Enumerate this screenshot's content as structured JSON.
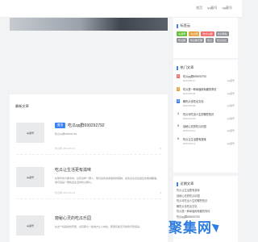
{
  "header": {
    "links": [
      "首页",
      "qq靓号",
      "qq靓号"
    ]
  },
  "main": {
    "section_title": "最新文章",
    "posts": [
      {
        "thumb_label": "qq靓号",
        "tag": "置顶",
        "title": "吃瓜qq群699292792",
        "desc": "吃瓜qq群699292792",
        "meta": "吃瓜网 2024-05-13",
        "count": "5"
      },
      {
        "thumb_label": "qq靓号",
        "tag": "",
        "title": "吃瓜让生活更有滋味",
        "desc": "在繁华的大都市中，总有这样一群人，他们喜欢追求着新鲜事物，喜欢关注身边发生的各种趣事。他们就是一群热爱生活的吃瓜群众。",
        "meta": "吃瓜网 2024-05-13",
        "count": "4"
      },
      {
        "thumb_label": "qq靓号",
        "tag": "",
        "title": "窥秘心灵的吃瓜乐园",
        "desc": "在这个喧嚣的世界里，总有那么一些地方让人向往，那里有着无尽的欢乐和惊喜。",
        "meta": "",
        "count": ""
      }
    ]
  },
  "sidebar": {
    "tags_title": "标签云",
    "tags": [
      {
        "label": "qq靓号",
        "color": "#67c23a"
      },
      {
        "label": "吃瓜网",
        "color": "#e6a23c"
      },
      {
        "label": "吃瓜qq群",
        "color": "#f56c6c"
      },
      {
        "label": "吃瓜网站",
        "color": "#909399"
      },
      {
        "label": "吃瓜群",
        "color": "#909399"
      },
      {
        "label": "吃瓜聊天群",
        "color": "#909399"
      },
      {
        "label": "吃瓜",
        "color": "#909399"
      },
      {
        "label": "吃瓜论坛",
        "color": "#909399"
      }
    ],
    "hot_title": "热门文章",
    "hot": [
      {
        "num": "1",
        "title": "吃瓜qq群699292792",
        "date": "2024-05-11",
        "author": "qq靓号",
        "color": "#f56c6c"
      },
      {
        "num": "2",
        "title": "吃瓜是一种幸福而有趣的事情",
        "date": "2024-05-05",
        "author": "qq靓号",
        "color": "#e6a23c"
      },
      {
        "num": "3",
        "title": "瞧吃瓜也吃出文化",
        "date": "2024-05-08",
        "author": "qq靓号",
        "color": "#3b82f6"
      },
      {
        "num": "4",
        "title": "吃瓜可吃出人生的哪些知识",
        "date": "2024-02-03",
        "author": "qq靓号",
        "color": ""
      },
      {
        "num": "5",
        "title": "窥秘心灵的吃瓜乐园",
        "date": "2024-02-12",
        "author": "qq靓号",
        "color": ""
      },
      {
        "num": "6",
        "title": "吃瓜让生活更有滋味",
        "date": "2024-05-13",
        "author": "qq靓号",
        "color": ""
      }
    ],
    "rec_title": "近期文章",
    "recent": [
      "吃瓜让生活更有滋味",
      "窥秘心灵的吃瓜乐园",
      "吃瓜可吃出人生的哪些知识",
      "瞧吃瓜也吃出文化",
      "吃瓜是一种幸福而有趣的事情",
      "吃瓜qq群699292792"
    ]
  },
  "watermark": {
    "text": "聚集网"
  }
}
